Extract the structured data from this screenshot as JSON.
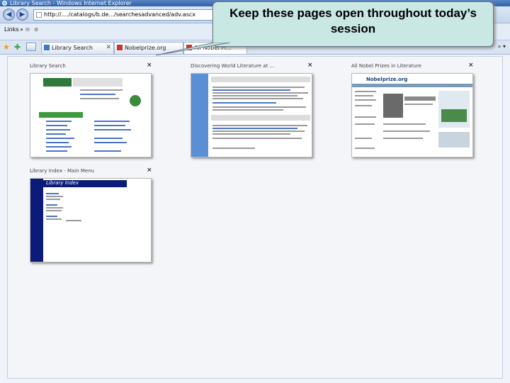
{
  "window": {
    "title": "Library Search - Windows Internet Explorer"
  },
  "address": {
    "url": "http://..../catalogs/b.de.../searchesadvanced/adv.ascx"
  },
  "links_bar": {
    "links_label": "Links",
    "chevron": "»"
  },
  "tabs": [
    {
      "label": "Library Search",
      "icon": "page-icon"
    },
    {
      "label": "Nobelprize.org",
      "icon": "page-icon"
    },
    {
      "label": "All Nobel Pr...",
      "icon": "page-icon"
    }
  ],
  "callout": {
    "text": "Keep these pages open throughout today’s session"
  },
  "thumbnails": [
    {
      "title": "Library Search",
      "close": "×"
    },
    {
      "title": "Discovering World Literature at ...",
      "close": "×"
    },
    {
      "title": "All Nobel Prizes in Literature",
      "close": "×"
    },
    {
      "title": "Library Index - Main Menu",
      "close": "×"
    }
  ],
  "thumbnail_texts": {
    "nobel_logo": "Nobelprize.org",
    "library_index_banner": "Library Index"
  },
  "colors": {
    "title_bar": "#2e5fa8",
    "callout_bg": "#c9e7e3",
    "library_index_blue": "#0c1a7a"
  }
}
